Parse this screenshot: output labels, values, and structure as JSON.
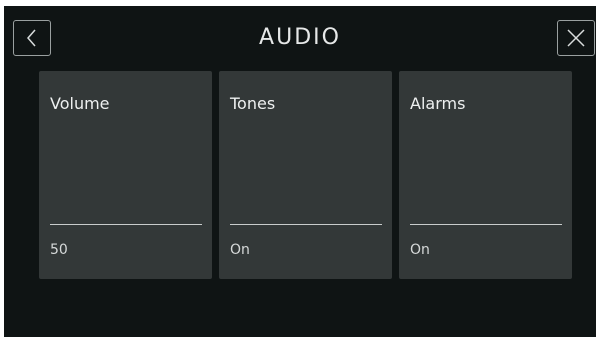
{
  "header": {
    "title": "AUDIO",
    "back_icon": "chevron-left-icon",
    "close_icon": "close-icon"
  },
  "tiles": [
    {
      "label": "Volume",
      "value": "50"
    },
    {
      "label": "Tones",
      "value": "On"
    },
    {
      "label": "Alarms",
      "value": "On"
    }
  ],
  "colors": {
    "background": "#0f1414",
    "tile": "#333838",
    "text": "#eef0f0",
    "divider": "#c9cccc",
    "icon_border": "#9aa0a0"
  }
}
